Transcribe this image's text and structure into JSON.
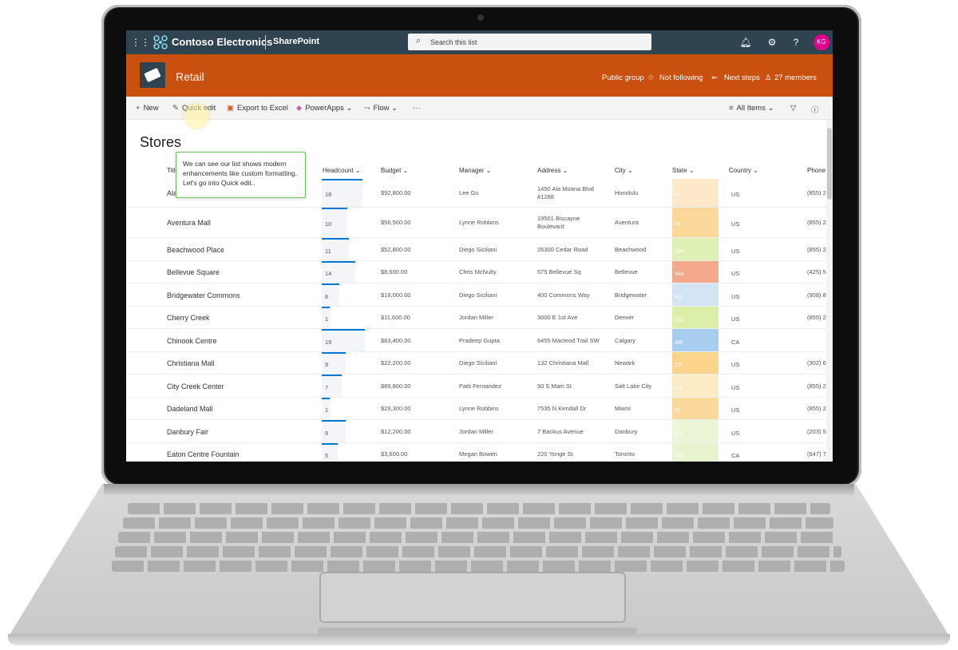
{
  "suite": {
    "brand": "Contoso Electronics",
    "app": "SharePoint",
    "search_placeholder": "Search this list",
    "avatar_initials": "KG"
  },
  "site": {
    "title": "Retail",
    "public_group": "Public group",
    "following": "Not following",
    "next_steps": "Next steps",
    "members": "27 members"
  },
  "commands": {
    "new": "New",
    "quick_edit": "Quick edit",
    "export": "Export to Excel",
    "powerapps": "PowerApps",
    "flow": "Flow",
    "more": "···",
    "view": "All Items"
  },
  "list": {
    "title": "Stores",
    "tooltip": "We can see our list shows modern enhancements like custom formatting. Let's go into Quick edit..",
    "columns": {
      "title": "Title",
      "headcount": "Headcount",
      "budget": "Budget",
      "manager": "Manager",
      "address": "Address",
      "city": "City",
      "state": "State",
      "country": "Country",
      "phone": "Phone"
    },
    "rows": [
      {
        "title": "Ala Moana Center",
        "headcount": "18",
        "hc": 18,
        "budget": "$92,800.00",
        "manager": "Lee Gu",
        "address": "1450 Ala Moana Blvd",
        "address2": "#1288",
        "city": "Honolulu",
        "state": "HI",
        "state_color": "#fde9c9",
        "country": "US",
        "phone": "(855) 2"
      },
      {
        "title": "Aventura Mall",
        "headcount": "10",
        "hc": 10,
        "budget": "$56,500.00",
        "manager": "Lynne Robbins",
        "address": "19501 Biscayne",
        "address2": "Boulevard",
        "city": "Aventura",
        "state": "FL",
        "state_color": "#fcd99a",
        "country": "US",
        "phone": "(855) 2"
      },
      {
        "title": "Beachwood Place",
        "headcount": "11",
        "hc": 11,
        "budget": "$52,800.00",
        "manager": "Diego Siciliani",
        "address": "26300 Cedar Road",
        "address2": "",
        "city": "Beachwood",
        "state": "OH",
        "state_color": "#dff0b5",
        "country": "US",
        "phone": "(855) 2"
      },
      {
        "title": "Bellevue Square",
        "headcount": "14",
        "hc": 14,
        "budget": "$8,600.00",
        "manager": "Chris McNulty",
        "address": "575 Bellevue Sq",
        "address2": "",
        "city": "Bellevue",
        "state": "WA",
        "state_color": "#f4a98c",
        "country": "US",
        "phone": "(425) 5"
      },
      {
        "title": "Bridgewater Commons",
        "headcount": "6",
        "hc": 6,
        "budget": "$18,000.00",
        "manager": "Diego Siciliani",
        "address": "400 Commons Way",
        "address2": "",
        "city": "Bridgewater",
        "state": "NJ",
        "state_color": "#d3e4f4",
        "country": "US",
        "phone": "(908) 8"
      },
      {
        "title": "Cherry Creek",
        "headcount": "1",
        "hc": 1,
        "budget": "$11,600.00",
        "manager": "Jordan Miller",
        "address": "3000 E 1st Ave",
        "address2": "",
        "city": "Denver",
        "state": "CO",
        "state_color": "#dcefa8",
        "country": "US",
        "phone": "(855) 2"
      },
      {
        "title": "Chinook Centre",
        "headcount": "19",
        "hc": 19,
        "budget": "$83,400.00",
        "manager": "Pradeep Gupta",
        "address": "6455 Macleod Trail SW",
        "address2": "",
        "city": "Calgary",
        "state": "AB",
        "state_color": "#a8cdee",
        "country": "CA",
        "phone": ""
      },
      {
        "title": "Christiana Mall",
        "headcount": "9",
        "hc": 9,
        "budget": "$22,200.00",
        "manager": "Diego Siciliani",
        "address": "132 Christiana Mall",
        "address2": "",
        "city": "Newark",
        "state": "DE",
        "state_color": "#fcd48c",
        "country": "US",
        "phone": "(302) 6"
      },
      {
        "title": "City Creek Center",
        "headcount": "7",
        "hc": 7,
        "budget": "$89,800.00",
        "manager": "Patti Fernandez",
        "address": "50 S Main St",
        "address2": "",
        "city": "Salt Lake City",
        "state": "UT",
        "state_color": "#fdebc6",
        "country": "US",
        "phone": "(855) 2"
      },
      {
        "title": "Dadeland Mall",
        "headcount": "1",
        "hc": 1,
        "budget": "$29,300.00",
        "manager": "Lynne Robbins",
        "address": "7535 N Kendall Dr",
        "address2": "",
        "city": "Miami",
        "state": "FL",
        "state_color": "#fcd99a",
        "country": "US",
        "phone": "(855) 2"
      },
      {
        "title": "Danbury Fair",
        "headcount": "9",
        "hc": 9,
        "budget": "$12,200.00",
        "manager": "Jordan Miller",
        "address": "7 Backus Avenue",
        "address2": "",
        "city": "Danbury",
        "state": "CT",
        "state_color": "#ecf6d6",
        "country": "US",
        "phone": "(203) 5"
      },
      {
        "title": "Eaton Centre Fountain",
        "headcount": "5",
        "hc": 5,
        "budget": "$3,600.00",
        "manager": "Megan Bowen",
        "address": "220 Yonge St",
        "address2": "",
        "city": "Toronto",
        "state": "ON",
        "state_color": "#e8f4cf",
        "country": "CA",
        "phone": "(647) 7"
      }
    ]
  }
}
